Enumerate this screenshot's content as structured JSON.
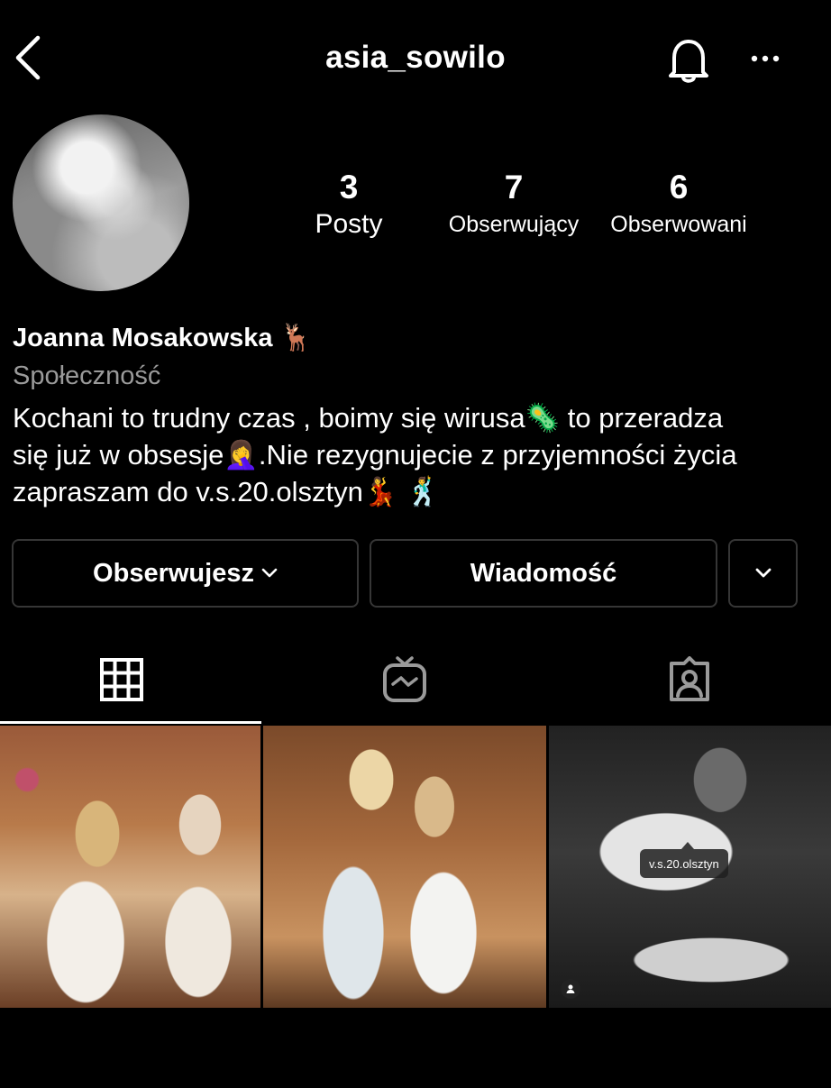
{
  "header": {
    "username": "asia_sowilo"
  },
  "stats": [
    {
      "value": "3",
      "label": "Posty"
    },
    {
      "value": "7",
      "label": "Obserwujący"
    },
    {
      "value": "6",
      "label": "Obserwowani"
    }
  ],
  "profile": {
    "name": "Joanna Mosakowska 🦌",
    "category": "Społeczność",
    "bio_lines": [
      "Kochani to trudny czas , boimy się wirusa🦠 to przeradza",
      "się już w obsesje🤦‍♀️.Nie rezygnujecie z przyjemności życia",
      "zapraszam do v.s.20.olsztyn💃 🕺"
    ]
  },
  "actions": {
    "following_label": "Obserwujesz",
    "message_label": "Wiadomość"
  },
  "tabs": [
    "grid-icon",
    "igtv-icon",
    "tagged-icon"
  ],
  "posts": {
    "tag_label": "v.s.20.olsztyn"
  }
}
